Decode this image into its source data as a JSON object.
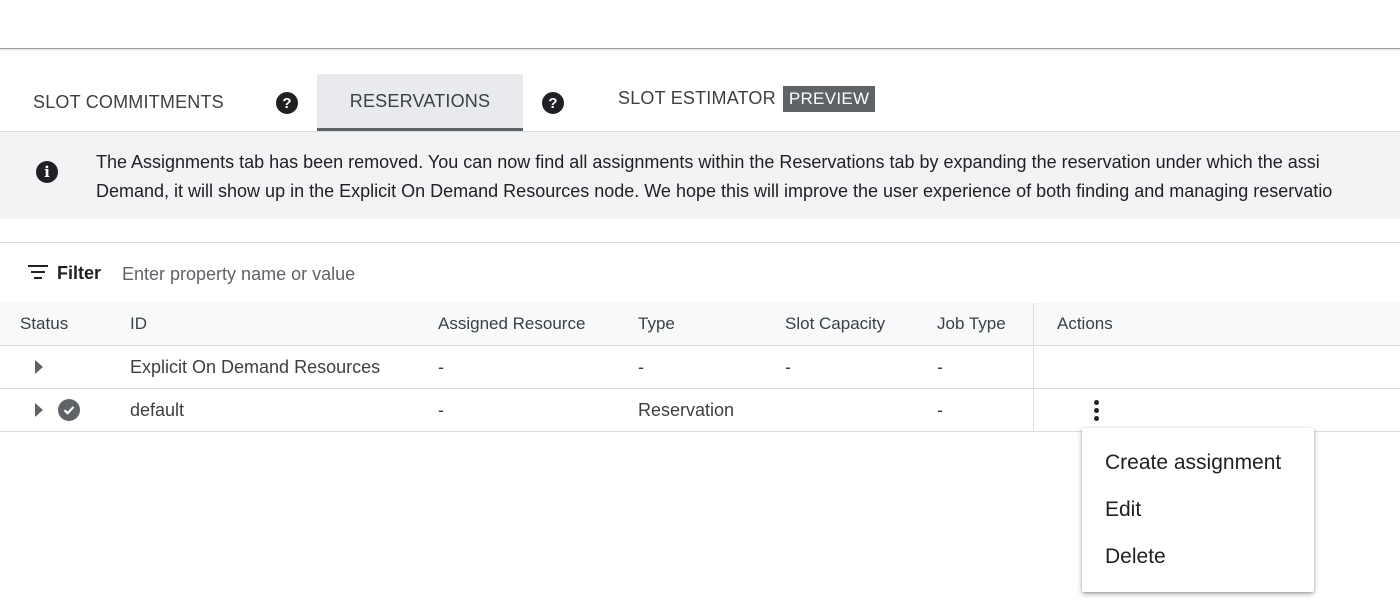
{
  "tabs": {
    "slot_commitments": "SLOT COMMITMENTS",
    "reservations": "RESERVATIONS",
    "slot_estimator": "SLOT ESTIMATOR",
    "preview_badge": "PREVIEW",
    "help_glyph": "?"
  },
  "banner": {
    "icon": "info-icon",
    "line1": "The Assignments tab has been removed. You can now find all assignments within the Reservations tab by expanding the reservation under which the assi",
    "line2": "Demand, it will show up in the Explicit On Demand Resources node. We hope this will improve the user experience of both finding and managing reservatio"
  },
  "filter": {
    "label": "Filter",
    "placeholder": "Enter property name or value",
    "value": ""
  },
  "table": {
    "headers": {
      "status": "Status",
      "id": "ID",
      "assigned_resource": "Assigned Resource",
      "type": "Type",
      "slot_capacity": "Slot Capacity",
      "job_type": "Job Type",
      "actions": "Actions"
    },
    "rows": [
      {
        "id": "Explicit On Demand Resources",
        "assigned_resource": "-",
        "type": "-",
        "slot_capacity": "-",
        "job_type": "-",
        "status_icon": ""
      },
      {
        "id": "default",
        "assigned_resource": "-",
        "type": "Reservation",
        "slot_capacity": "",
        "job_type": "-",
        "status_icon": "check-circle-icon"
      }
    ]
  },
  "menu": {
    "items": [
      "Create assignment",
      "Edit",
      "Delete"
    ]
  },
  "colors": {
    "active_tab_bg": "#e8eaed",
    "banner_bg": "#f1f3f4",
    "badge_bg": "#5f6368",
    "text": "#202124"
  }
}
